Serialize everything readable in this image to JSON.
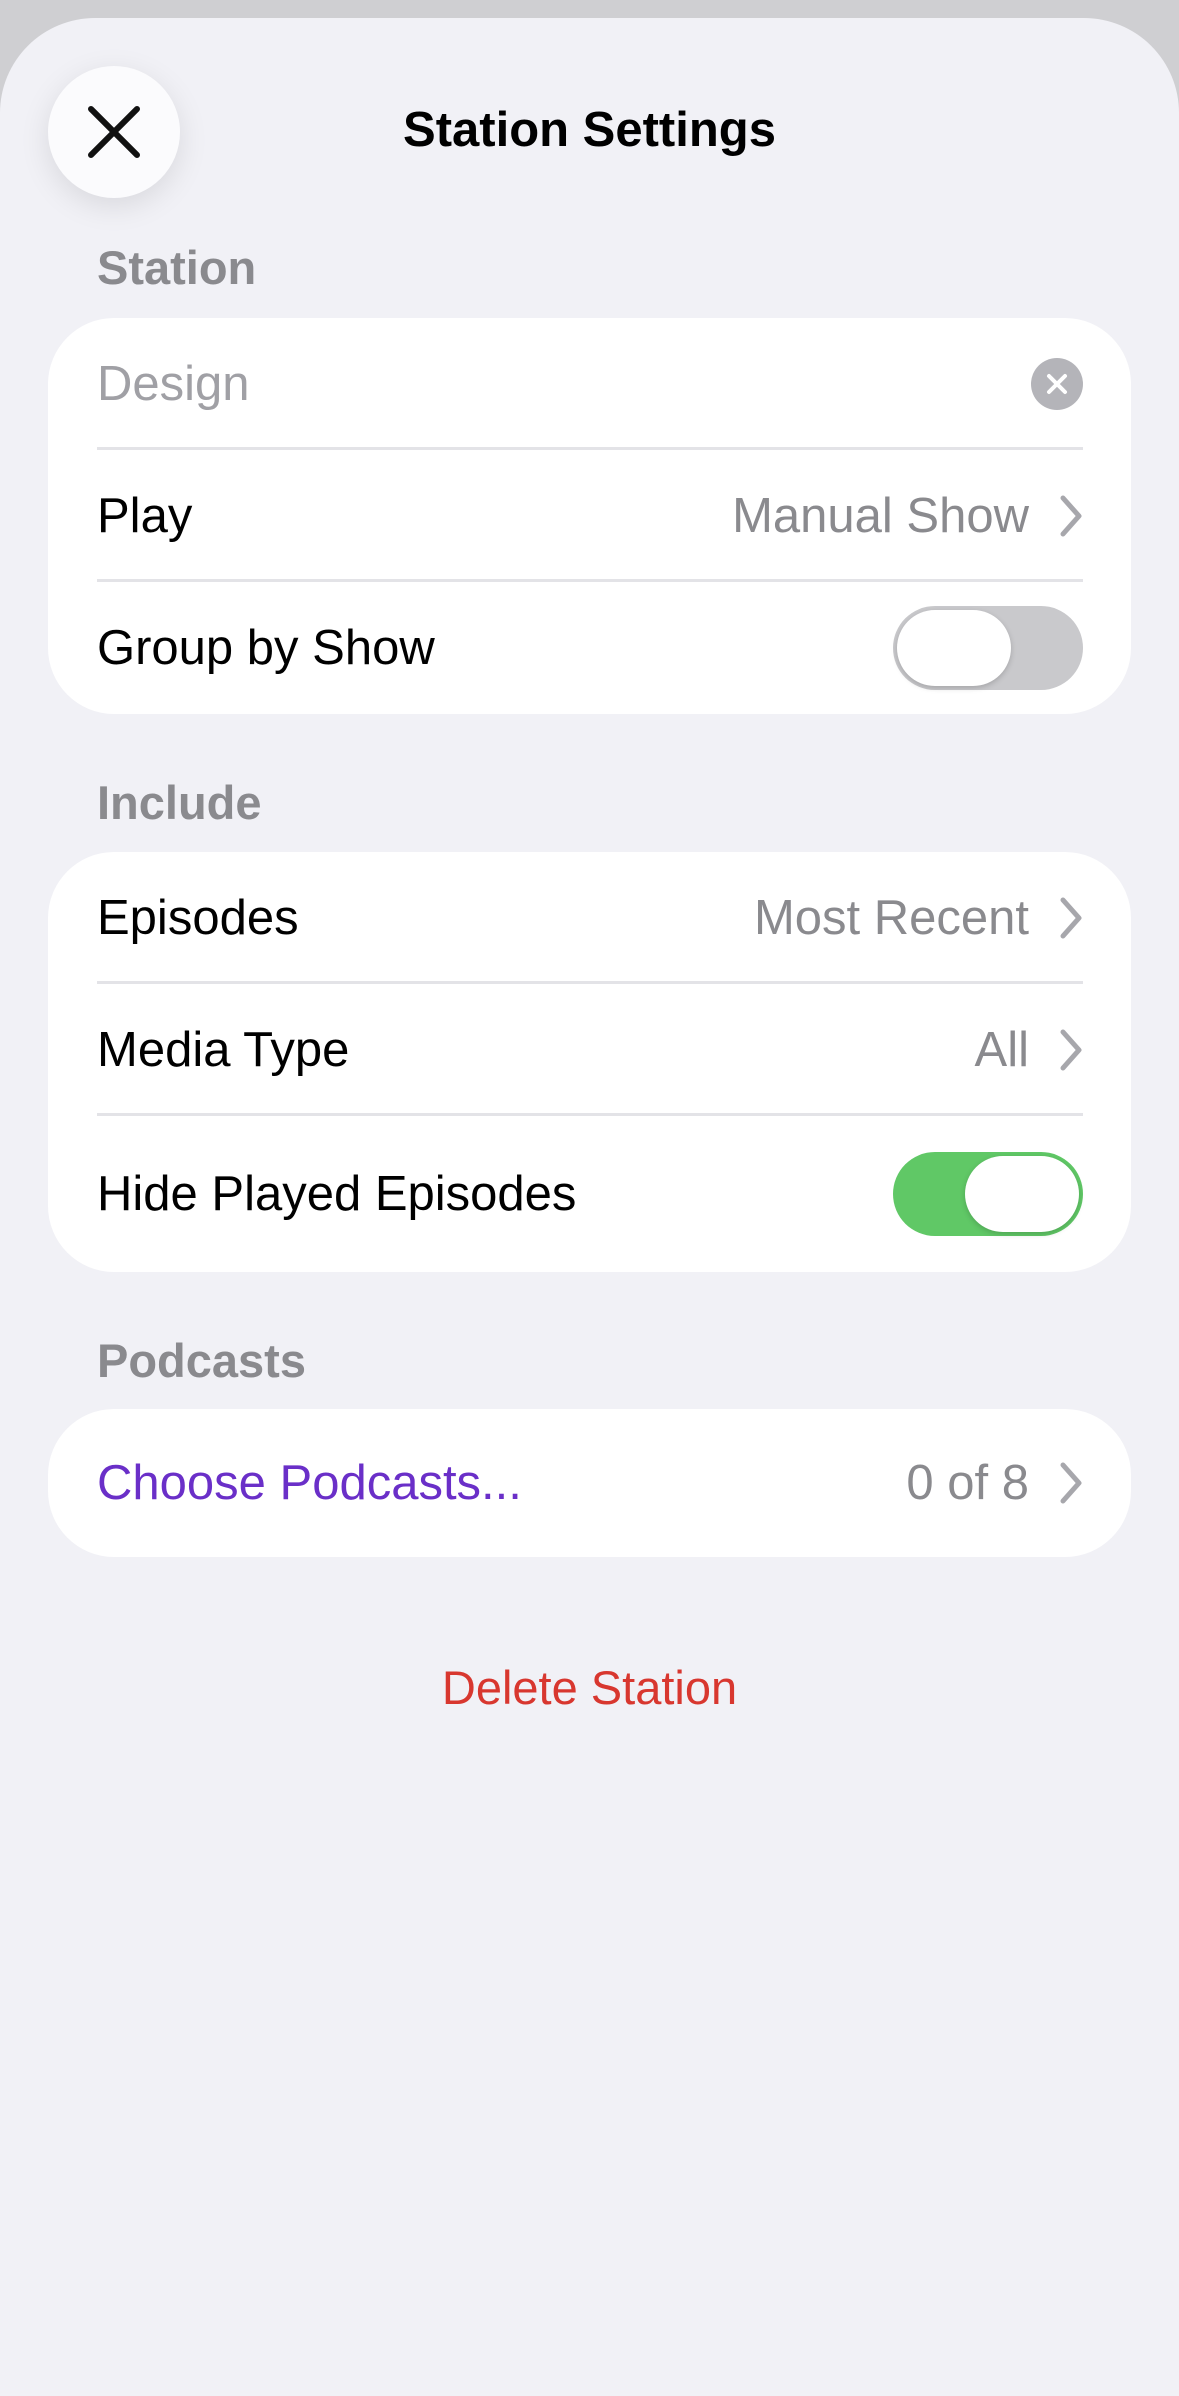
{
  "header": {
    "title": "Station Settings"
  },
  "station": {
    "section_title": "Station",
    "name_placeholder": "Design",
    "play_label": "Play",
    "play_value": "Manual Show",
    "group_label": "Group by Show",
    "group_on": false
  },
  "include": {
    "section_title": "Include",
    "episodes_label": "Episodes",
    "episodes_value": "Most Recent",
    "media_label": "Media Type",
    "media_value": "All",
    "hide_played_label": "Hide Played Episodes",
    "hide_played_on": true
  },
  "podcasts": {
    "section_title": "Podcasts",
    "choose_label": "Choose Podcasts...",
    "choose_count": "0 of 8"
  },
  "actions": {
    "delete_label": "Delete Station"
  },
  "colors": {
    "accent": "#6a2fc8",
    "destructive": "#d8372f",
    "toggle_on": "#60c866",
    "toggle_off": "#c9c9cc"
  }
}
